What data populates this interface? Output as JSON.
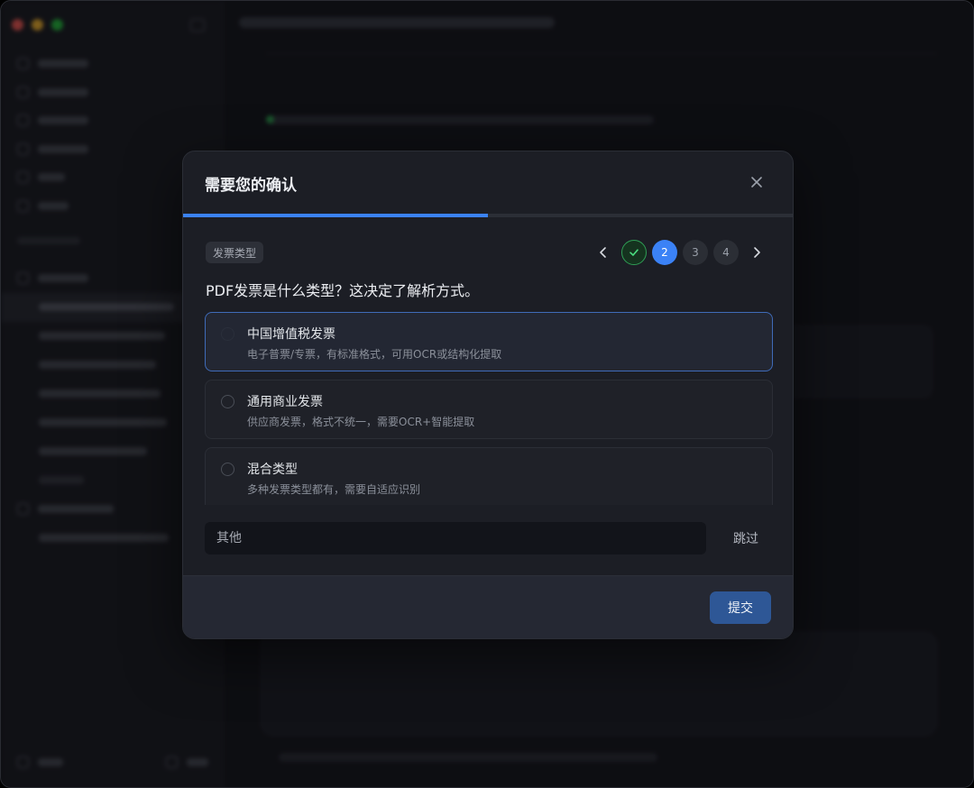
{
  "modal": {
    "title": "需要您的确认",
    "progress_fraction": 0.5,
    "question_tag": "发票类型",
    "question": "PDF发票是什么类型？这决定了解析方式。",
    "steps": [
      {
        "label": "",
        "state": "done"
      },
      {
        "label": "2",
        "state": "current"
      },
      {
        "label": "3",
        "state": "pending"
      },
      {
        "label": "4",
        "state": "pending"
      }
    ],
    "options": [
      {
        "title": "中国增值税发票",
        "desc": "电子普票/专票，有标准格式，可用OCR或结构化提取",
        "selected": true
      },
      {
        "title": "通用商业发票",
        "desc": "供应商发票，格式不统一，需要OCR+智能提取",
        "selected": false
      },
      {
        "title": "混合类型",
        "desc": "多种发票类型都有，需要自适应识别",
        "selected": false
      }
    ],
    "other_placeholder": "其他",
    "skip_label": "跳过",
    "submit_label": "提交"
  },
  "colors": {
    "accent": "#3b82f6",
    "submit": "#2e5796",
    "done_green": "#2f9e55",
    "backdrop": "#17181d"
  },
  "icons": {
    "close": "close-icon",
    "prev": "chevron-left-icon",
    "next": "chevron-right-icon",
    "done": "check-icon"
  }
}
